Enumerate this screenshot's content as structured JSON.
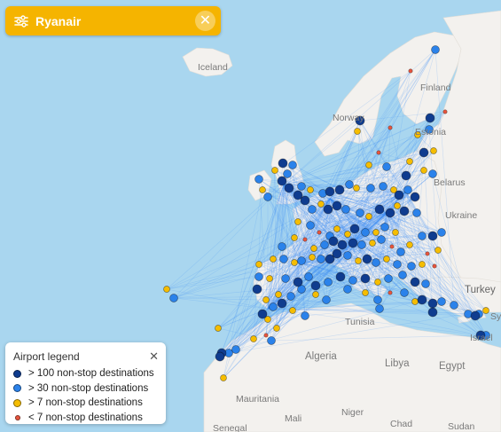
{
  "airline": {
    "name": "Ryanair"
  },
  "colors": {
    "sea": "#a9d6ef",
    "land": "#f3f1ee",
    "route": "#3d8ef7",
    "accent": "#f5b400",
    "hub_large": "#0f3c8f",
    "hub_medium": "#2b82ea",
    "hub_small": "#f5bd00",
    "hub_tiny": "#e8553e"
  },
  "legend": {
    "title": "Airport legend",
    "items": [
      {
        "label": "> 100 non-stop destinations",
        "color": "#0f3c8f"
      },
      {
        "label": "> 30 non-stop destinations",
        "color": "#2b82ea"
      },
      {
        "label": "> 7 non-stop destinations",
        "color": "#f5bd00"
      },
      {
        "label": "< 7 non-stop destinations",
        "color": "#e8553e"
      }
    ]
  },
  "map_labels": [
    "Iceland",
    "Finland",
    "Norway",
    "Estonia",
    "Belarus",
    "Ukraine",
    "Turkey",
    "Tunisia",
    "Algeria",
    "Libya",
    "Egypt",
    "Mauritania",
    "Mali",
    "Niger",
    "Chad",
    "Sudan",
    "Senegal",
    "Syria",
    "Israel"
  ]
}
